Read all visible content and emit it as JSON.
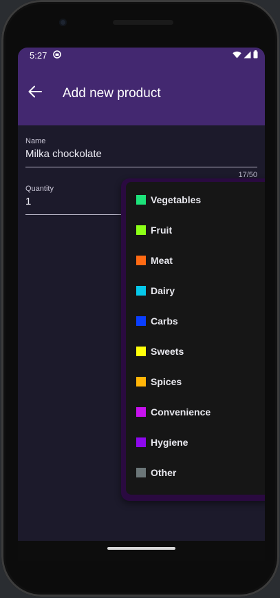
{
  "status_bar": {
    "time": "5:27",
    "app_icon": "app-notification-icon",
    "indicators": [
      "wifi-icon",
      "signal-icon",
      "battery-icon"
    ]
  },
  "toolbar": {
    "back_icon": "back-arrow-icon",
    "title": "Add new product"
  },
  "form": {
    "name": {
      "label": "Name",
      "value": "Milka chockolate",
      "counter": "17/50"
    },
    "quantity": {
      "label": "Quantity",
      "value": "1"
    }
  },
  "category_menu": {
    "items": [
      {
        "label": "Vegetables",
        "color": "#1de27a"
      },
      {
        "label": "Fruit",
        "color": "#8cff17"
      },
      {
        "label": "Meat",
        "color": "#ff6a13"
      },
      {
        "label": "Dairy",
        "color": "#06c8ea"
      },
      {
        "label": "Carbs",
        "color": "#0a3fff"
      },
      {
        "label": "Sweets",
        "color": "#ffff0a"
      },
      {
        "label": "Spices",
        "color": "#ffb508"
      },
      {
        "label": "Convenience",
        "color": "#c712ee"
      },
      {
        "label": "Hygiene",
        "color": "#8d08ec"
      },
      {
        "label": "Other",
        "color": "#6b7678"
      }
    ]
  },
  "colors": {
    "app_bar": "#432870",
    "background": "#1c1a2b",
    "menu_background": "#161616"
  }
}
